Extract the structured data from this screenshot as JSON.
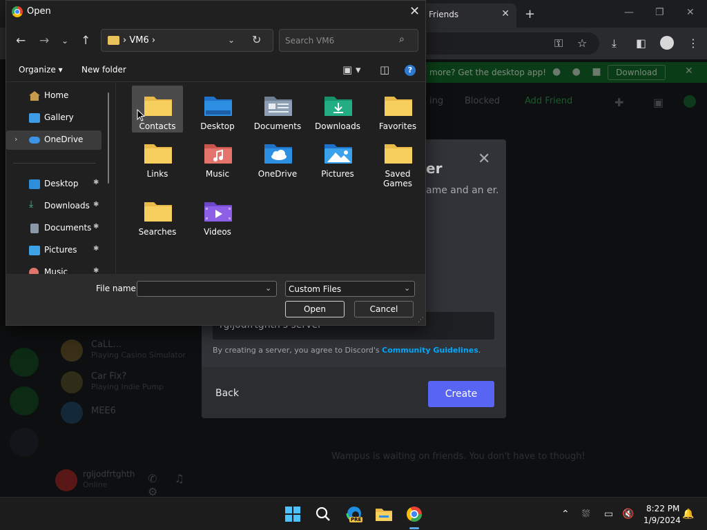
{
  "browser": {
    "tab_title": "Friends",
    "tab_close": "✕",
    "new_tab": "+",
    "banner_text": "more? Get the desktop app!",
    "banner_button": "Download",
    "banner_close": "✕",
    "nav_pending": "ing",
    "nav_blocked": "Blocked",
    "nav_add_friend": "Add Friend"
  },
  "discord": {
    "dm_rows": [
      {
        "name": "CaLL…",
        "sub": "Playing Casino Simulator"
      },
      {
        "name": "Car Fix?",
        "sub": "Playing Indie Pump"
      },
      {
        "name": "MEE6",
        "sub": ""
      }
    ],
    "user_name": "rgljodfrtghth",
    "user_status": "Online",
    "wampus_text": "Wampus is waiting on friends. You don't have to though!",
    "modal": {
      "title": "er",
      "desc": "ame and an er.",
      "server_name_value": "rgljodfrtghth's server",
      "agree_text": "By creating a server, you agree to Discord's",
      "agree_link": "Community Guidelines",
      "agree_end": ".",
      "back": "Back",
      "create": "Create",
      "close": "✕"
    }
  },
  "dialog": {
    "title": "Open",
    "close": "✕",
    "address_current": "VM6",
    "search_placeholder": "Search VM6",
    "organize": "Organize",
    "new_folder": "New folder",
    "help": "?",
    "nav_items": [
      {
        "label": "Home",
        "icon": "home-icon"
      },
      {
        "label": "Gallery",
        "icon": "gallery-icon"
      },
      {
        "label": "OneDrive",
        "icon": "cloud-icon",
        "selected": true,
        "expandable": true
      },
      {
        "label": "Desktop",
        "icon": "desktop-icon",
        "pinned": true
      },
      {
        "label": "Downloads",
        "icon": "download-icon",
        "pinned": true
      },
      {
        "label": "Documents",
        "icon": "documents-icon",
        "pinned": true
      },
      {
        "label": "Pictures",
        "icon": "pictures-icon",
        "pinned": true
      },
      {
        "label": "Music",
        "icon": "music-icon",
        "pinned": true
      }
    ],
    "folders": [
      {
        "label": "Contacts",
        "icon": "folder-icon"
      },
      {
        "label": "Desktop",
        "icon": "desktop-folder-icon"
      },
      {
        "label": "Documents",
        "icon": "documents-folder-icon"
      },
      {
        "label": "Downloads",
        "icon": "downloads-folder-icon"
      },
      {
        "label": "Favorites",
        "icon": "folder-icon"
      },
      {
        "label": "Links",
        "icon": "folder-icon"
      },
      {
        "label": "Music",
        "icon": "music-folder-icon"
      },
      {
        "label": "OneDrive",
        "icon": "onedrive-folder-icon"
      },
      {
        "label": "Pictures",
        "icon": "pictures-folder-icon"
      },
      {
        "label": "Saved Games",
        "icon": "folder-icon"
      },
      {
        "label": "Searches",
        "icon": "folder-icon"
      },
      {
        "label": "Videos",
        "icon": "videos-folder-icon"
      }
    ],
    "file_name_label": "File name:",
    "file_name_value": "",
    "file_type": "Custom Files",
    "open_button": "Open",
    "cancel_button": "Cancel"
  },
  "taskbar": {
    "time": "8:22 PM",
    "date": "1/9/2024",
    "edge_badge": "PRE"
  },
  "colors": {
    "folder_yellow": "#f1c453",
    "accent_blue": "#2f7ad1",
    "discord_blurple": "#5865f2",
    "banner_green": "#0a3d17"
  }
}
